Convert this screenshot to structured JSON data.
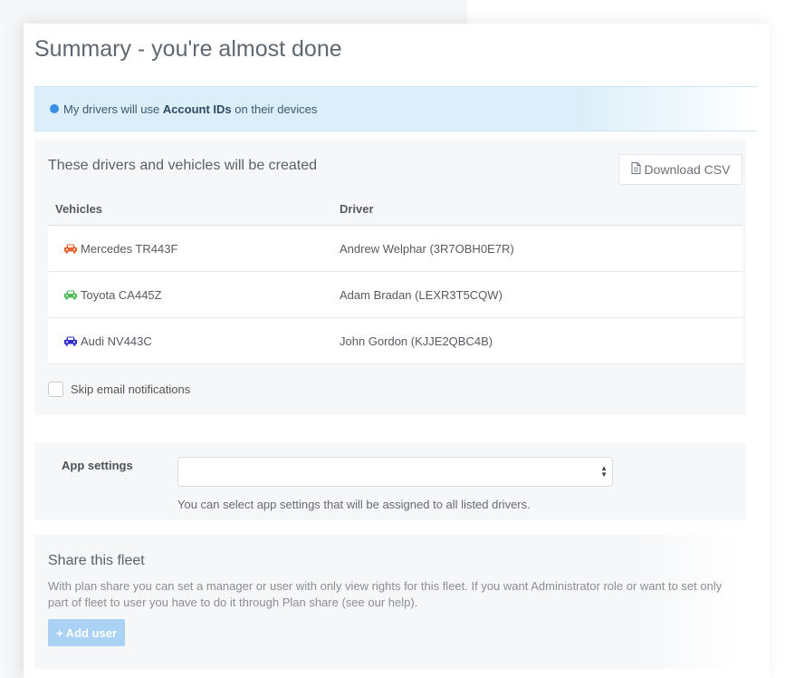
{
  "page": {
    "title": "Summary - you're almost done"
  },
  "alert": {
    "text_before": "My drivers will use",
    "text_bold": "Account IDs",
    "text_after": "on their devices"
  },
  "drivers_panel": {
    "heading": "These drivers and vehicles will be created",
    "download_label": "Download CSV",
    "columns": [
      "Vehicles",
      "Driver"
    ],
    "rows": [
      {
        "vehicle": "Mercedes TR443F",
        "driver": "Andrew Welphar (3R7OBH0E7R)",
        "car_color": "#e8622c"
      },
      {
        "vehicle": "Toyota CA445Z",
        "driver": "Adam Bradan (LEXR3T5CQW)",
        "car_color": "#4cbb5a"
      },
      {
        "vehicle": "Audi NV443C",
        "driver": "John Gordon (KJJE2QBC4B)",
        "car_color": "#2e2fc9"
      }
    ],
    "skip_label": "Skip email notifications",
    "skip_checked": false
  },
  "app_settings": {
    "label": "App settings",
    "selected_value": "",
    "help": "You can select app settings that will be assigned to all listed drivers."
  },
  "share": {
    "heading": "Share this fleet",
    "description": "With plan share you can set a manager or user with only view rights for this fleet. If you want Administrator role or want to set only part of fleet to user you have to do it through Plan share (see our help).",
    "add_label": "+ Add user"
  }
}
